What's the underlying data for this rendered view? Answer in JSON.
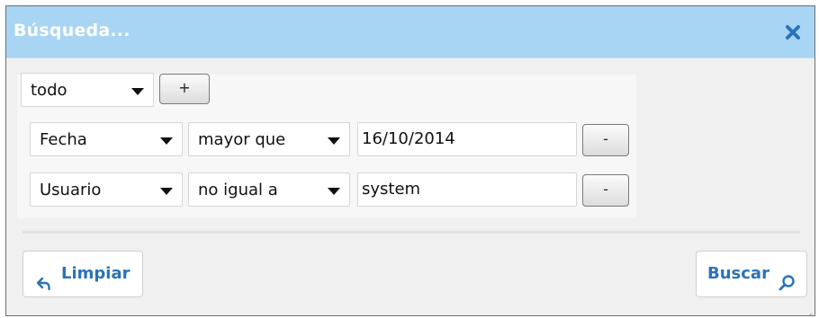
{
  "dialog": {
    "title": "Búsqueda...",
    "close_icon": "close-x-icon",
    "accent_color": "#2a73b8",
    "titlebar_color": "#a8d5f3"
  },
  "match_mode": {
    "value": "todo"
  },
  "add_button": {
    "label": "+"
  },
  "criteria": [
    {
      "field": "Fecha",
      "operator": "mayor que",
      "value": "16/10/2014",
      "remove_label": "-"
    },
    {
      "field": "Usuario",
      "operator": "no igual a",
      "value": "system",
      "remove_label": "-"
    }
  ],
  "footer": {
    "clear_label": "Limpiar",
    "clear_icon": "undo-arrow-icon",
    "search_label": "Buscar",
    "search_icon": "search-icon"
  }
}
